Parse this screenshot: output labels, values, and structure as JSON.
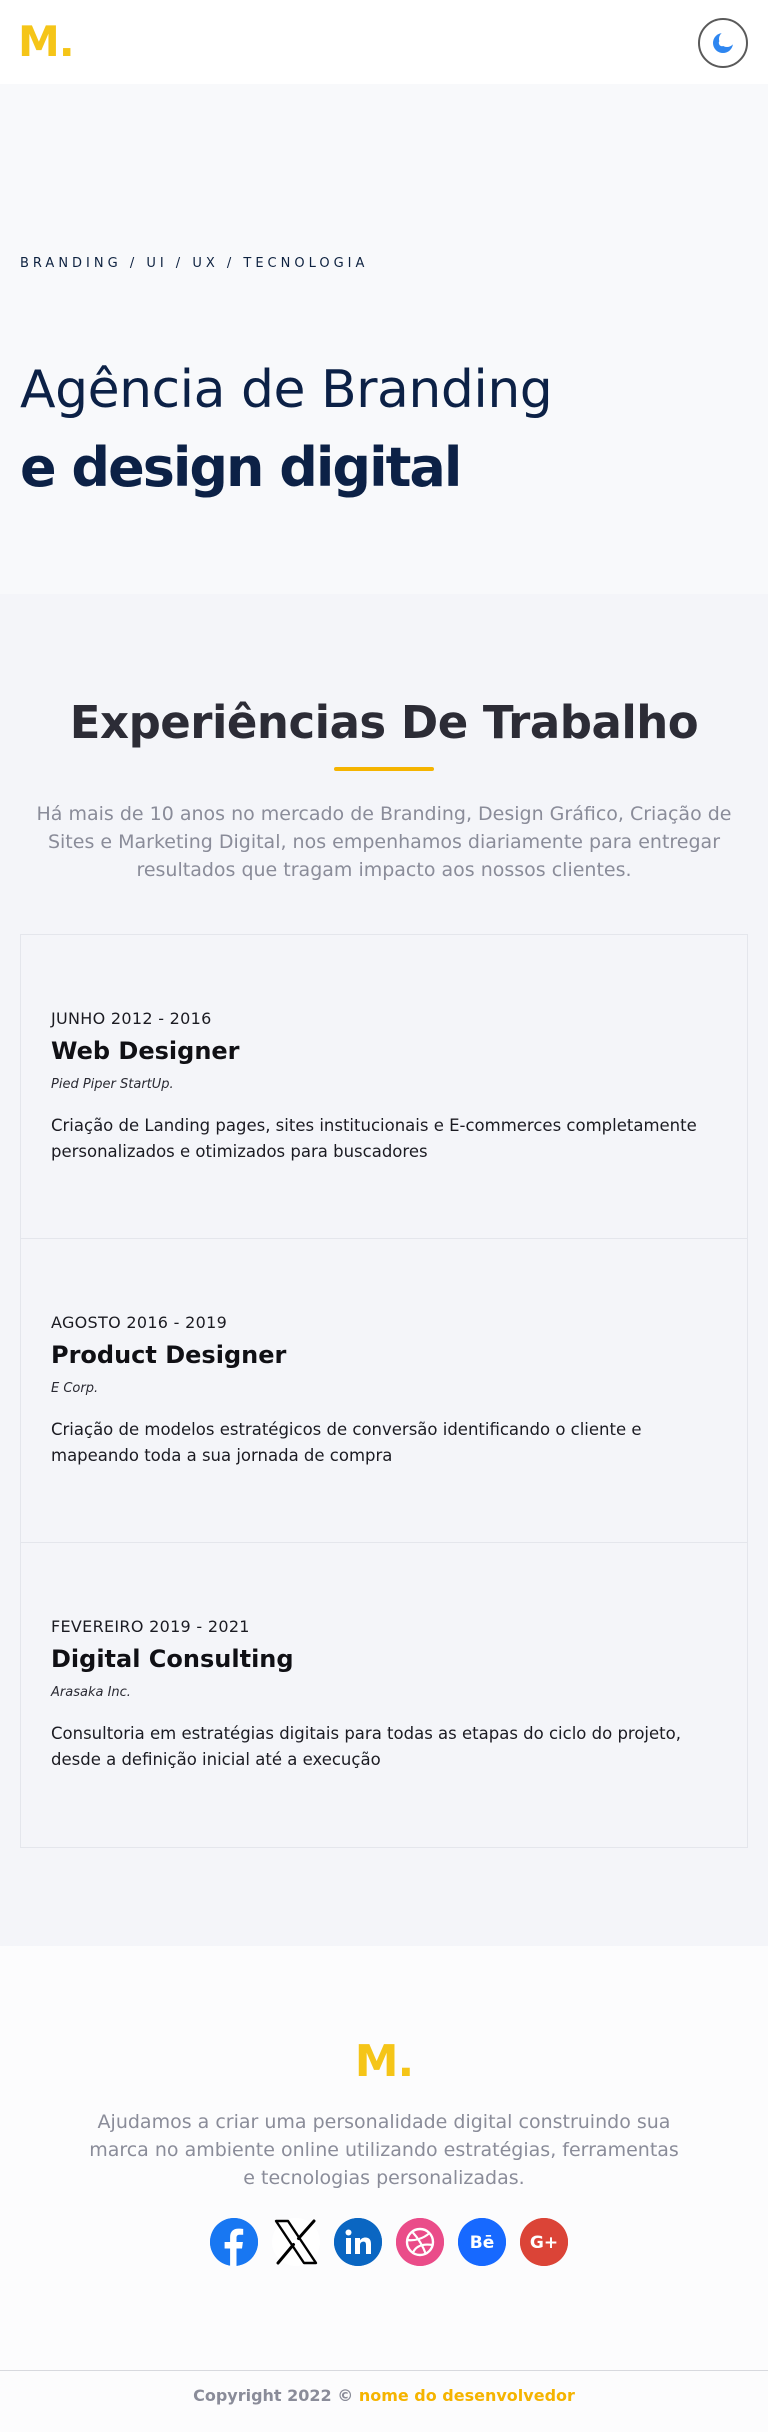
{
  "header": {
    "logo": "M.",
    "theme_toggle_icon": "moon-icon"
  },
  "hero": {
    "tags": "BRANDING / UI / UX / TECNOLOGIA",
    "title_line1": "Agência de Branding",
    "title_line2": "e design digital"
  },
  "experience": {
    "title": "Experiências De Trabalho",
    "intro": "Há mais de 10 anos no mercado de Branding, Design Gráfico, Criação de Sites e Marketing Digital, nos empenhamos diariamente para entregar resultados que tragam impacto aos nossos clientes.",
    "items": [
      {
        "date": "JUNHO 2012 - 2016",
        "role": "Web Designer",
        "company": "Pied Piper StartUp.",
        "description": "Criação de Landing pages, sites institucionais e E-commerces completamente personalizados e otimizados para buscadores"
      },
      {
        "date": "AGOSTO 2016 - 2019",
        "role": "Product Designer",
        "company": "E Corp.",
        "description": "Criação de modelos estratégicos de conversão identificando o cliente e mapeando toda a sua jornada de compra"
      },
      {
        "date": "FEVEREIRO 2019 - 2021",
        "role": "Digital Consulting",
        "company": "Arasaka Inc.",
        "description": "Consultoria em estratégias digitais para todas as etapas do ciclo do projeto, desde a definição inicial até a execução"
      }
    ]
  },
  "footer": {
    "logo": "M.",
    "text": "Ajudamos a criar uma personalidade digital construindo sua marca no ambiente online utilizando estratégias, ferramentas e tecnologias personalizadas.",
    "socials": [
      {
        "name": "facebook-icon",
        "color": "#1877f2"
      },
      {
        "name": "x-icon",
        "color": "#000000"
      },
      {
        "name": "linkedin-icon",
        "color": "#0a66c2"
      },
      {
        "name": "dribbble-icon",
        "color": "#ea4c89"
      },
      {
        "name": "behance-icon",
        "color": "#1769ff"
      },
      {
        "name": "google-plus-icon",
        "color": "#db4437"
      }
    ],
    "copyright_prefix": "Copyright 2022 ©",
    "developer": "nome do desenvolvedor"
  }
}
